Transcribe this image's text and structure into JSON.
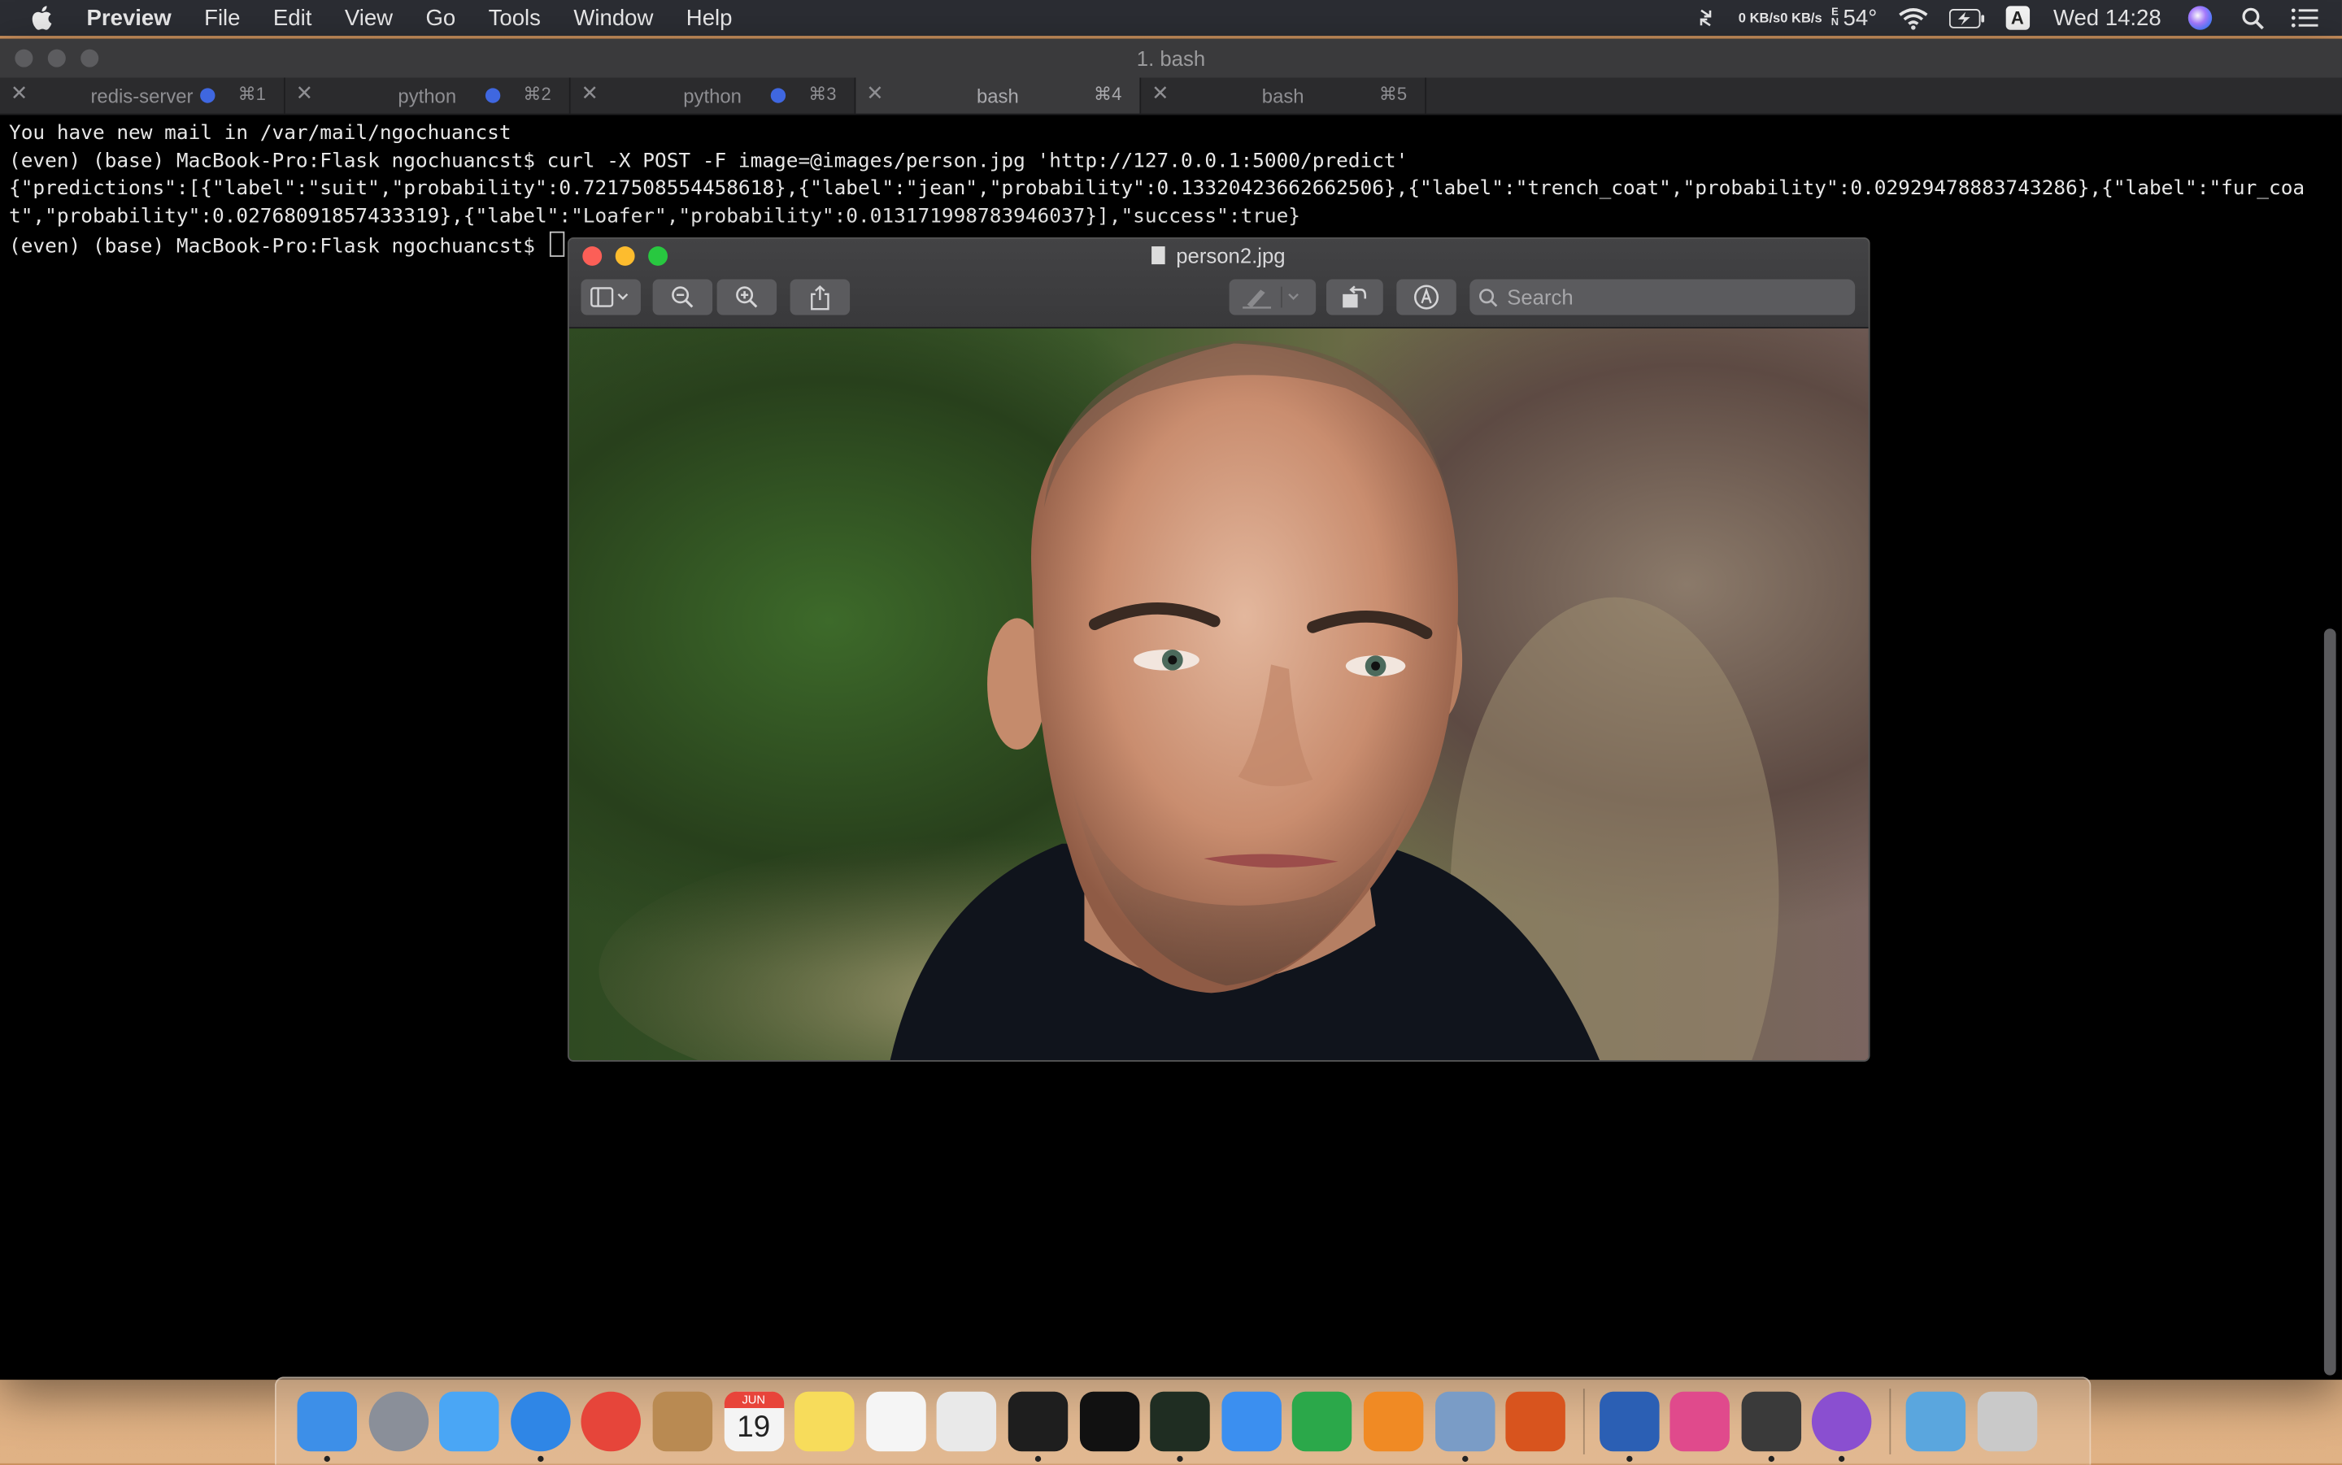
{
  "menubar": {
    "app_name": "Preview",
    "items": [
      "File",
      "Edit",
      "View",
      "Go",
      "Tools",
      "Window",
      "Help"
    ],
    "net_up": "0 KB/s",
    "net_down": "0 KB/s",
    "temp_flag_top": "E",
    "temp_flag_bottom": "N",
    "temperature": "54°",
    "input_source": "A",
    "clock": "Wed 14:28"
  },
  "terminal": {
    "title": "1. bash",
    "tabs": [
      {
        "label": "redis-server",
        "key": "⌘1",
        "activity": true
      },
      {
        "label": "python",
        "key": "⌘2",
        "activity": true
      },
      {
        "label": "python",
        "key": "⌘3",
        "activity": true
      },
      {
        "label": "bash",
        "key": "⌘4",
        "activity": false
      },
      {
        "label": "bash",
        "key": "⌘5",
        "activity": false
      }
    ],
    "lines": {
      "l1": "You have new mail in /var/mail/ngochuancst",
      "l2": "(even) (base) MacBook-Pro:Flask ngochuancst$ curl -X POST -F image=@images/person.jpg 'http://127.0.0.1:5000/predict'",
      "l3": "{\"predictions\":[{\"label\":\"suit\",\"probability\":0.7217508554458618},{\"label\":\"jean\",\"probability\":0.13320423662662506},{\"label\":\"trench_coat\",\"probability\":0.02929478883743286},{\"label\":\"fur_coat\",\"probability\":0.02768091857433319},{\"label\":\"Loafer\",\"probability\":0.013171998783946037}],\"success\":true}",
      "l4": "(even) (base) MacBook-Pro:Flask ngochuancst$ "
    }
  },
  "preview": {
    "filename": "person2.jpg",
    "search_placeholder": "Search"
  },
  "dock": {
    "calendar_month": "JUN",
    "calendar_day": "19",
    "icons": [
      {
        "name": "finder-icon",
        "color": "#3d8fe8",
        "running": true
      },
      {
        "name": "launchpad-icon",
        "color": "#8a8f99",
        "running": false
      },
      {
        "name": "messages-icon",
        "color": "#4aa6f5",
        "running": false
      },
      {
        "name": "safari-icon",
        "color": "#2f86e6",
        "running": true
      },
      {
        "name": "chrome-icon",
        "color": "#e6453a",
        "running": false
      },
      {
        "name": "contacts-icon",
        "color": "#b98a52",
        "running": false
      },
      {
        "name": "calendar-icon",
        "color": "#f4f4f4",
        "running": false
      },
      {
        "name": "notes-icon",
        "color": "#f7dc5b",
        "running": false
      },
      {
        "name": "reminders-icon",
        "color": "#f5f5f5",
        "running": false
      },
      {
        "name": "textedit-icon",
        "color": "#e9e9e9",
        "running": false
      },
      {
        "name": "iterm-icon",
        "color": "#1e1e1e",
        "running": true
      },
      {
        "name": "terminal-icon",
        "color": "#111111",
        "running": false
      },
      {
        "name": "activity-monitor-icon",
        "color": "#1f2d22",
        "running": true
      },
      {
        "name": "keynote-icon",
        "color": "#3b8ff0",
        "running": false
      },
      {
        "name": "numbers-icon",
        "color": "#2ba84a",
        "running": false
      },
      {
        "name": "pages-icon",
        "color": "#f08a24",
        "running": false
      },
      {
        "name": "preview-icon",
        "color": "#7a9cc6",
        "running": true
      },
      {
        "name": "matlab-icon",
        "color": "#d8541e",
        "running": false
      },
      {
        "name": "word-icon",
        "color": "#2b5fb4",
        "running": true
      },
      {
        "name": "pink-app-icon",
        "color": "#e04a8c",
        "running": false
      },
      {
        "name": "sublime-text-icon",
        "color": "#3a3a3a",
        "running": true
      },
      {
        "name": "github-desktop-icon",
        "color": "#8a4fd0",
        "running": true
      },
      {
        "name": "downloads-folder-icon",
        "color": "#5aa6de",
        "running": false
      },
      {
        "name": "trash-icon",
        "color": "#c9c9c9",
        "running": false
      }
    ]
  }
}
